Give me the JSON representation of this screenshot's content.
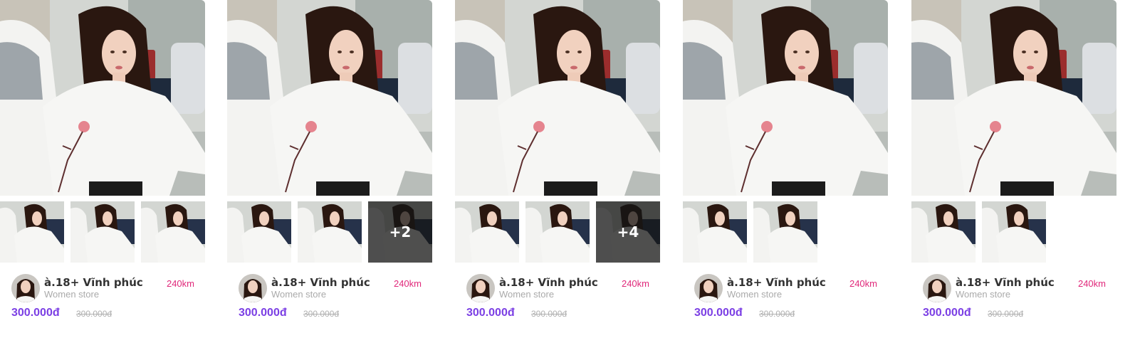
{
  "colors": {
    "price": "#7b3fe4",
    "distance": "#e0287a",
    "store_type": "#aaaaaa",
    "store_name": "#333333"
  },
  "cards": [
    {
      "store_name": "à.18+ Vĩnh phúc",
      "store_type": "Women store",
      "distance": "240km",
      "price": "300.000đ",
      "old_price": "300.000đ",
      "more_photos": ""
    },
    {
      "store_name": "à.18+ Vĩnh phúc",
      "store_type": "Women store",
      "distance": "240km",
      "price": "300.000đ",
      "old_price": "300.000đ",
      "more_photos": "+2"
    },
    {
      "store_name": "à.18+ Vĩnh phúc",
      "store_type": "Women store",
      "distance": "240km",
      "price": "300.000đ",
      "old_price": "300.000đ",
      "more_photos": "+4"
    },
    {
      "store_name": "à.18+ Vĩnh phúc",
      "store_type": "Women store",
      "distance": "240km",
      "price": "300.000đ",
      "old_price": "300.000đ",
      "more_photos": ""
    },
    {
      "store_name": "à.18+ Vĩnh phúc",
      "store_type": "Women store",
      "distance": "240km",
      "price": "300.000đ",
      "old_price": "300.000đ",
      "more_photos": ""
    }
  ]
}
